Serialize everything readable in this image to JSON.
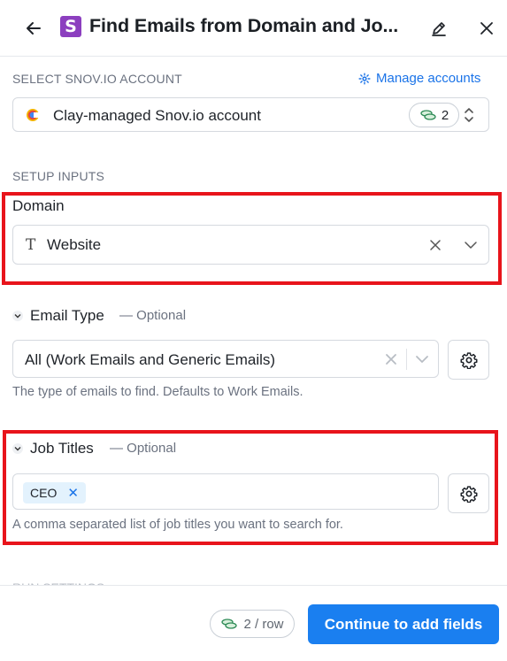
{
  "header": {
    "title": "Find Emails from Domain and Jo...",
    "logo_letter": "S",
    "logo_color": "#8c3fbf"
  },
  "account": {
    "section_label": "SELECT SNOV.IO ACCOUNT",
    "manage_label": "Manage accounts",
    "selected": "Clay-managed Snov.io account",
    "credits": "2"
  },
  "setup": {
    "section_label": "SETUP INPUTS",
    "domain": {
      "label": "Domain",
      "value": "Website"
    },
    "email_type": {
      "label": "Email Type",
      "optional": "— Optional",
      "value": "All (Work Emails and Generic Emails)",
      "hint": "The type of emails to find. Defaults to Work Emails."
    },
    "job_titles": {
      "label": "Job Titles",
      "optional": "— Optional",
      "tags": [
        "CEO"
      ],
      "hint": "A comma separated list of job titles you want to search for."
    }
  },
  "run_settings_label": "RUN SETTINGS",
  "footer": {
    "cost": "2 / row",
    "continue_label": "Continue to add fields"
  },
  "colors": {
    "accent": "#1a7ff0",
    "highlight": "#e8141b",
    "tag_bg": "#e3f2fd"
  }
}
